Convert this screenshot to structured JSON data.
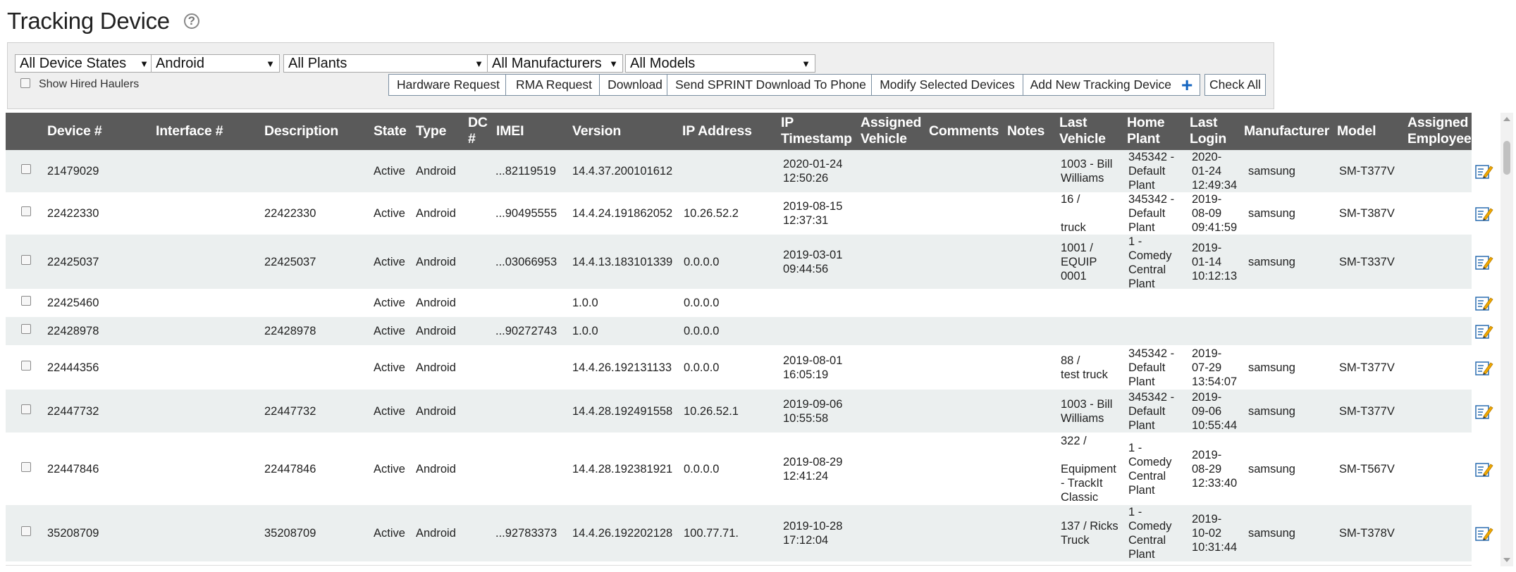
{
  "page": {
    "title": "Tracking Device"
  },
  "filters": {
    "device_state": "All Device States",
    "platform": "Android",
    "plants": "All Plants",
    "manufacturers": "All Manufacturers",
    "models": "All Models",
    "show_hired_haulers": "Show Hired Haulers"
  },
  "buttons": {
    "hardware_request": "Hardware Request",
    "rma_request": "RMA Request",
    "download": "Download",
    "send_sprint": "Send SPRINT Download To Phone",
    "modify_selected": "Modify Selected Devices",
    "add_new": "Add New Tracking Device",
    "check_all": "Check All"
  },
  "columns": {
    "device": "Device #",
    "interface": "Interface #",
    "description": "Description",
    "state": "State",
    "type": "Type",
    "dc_1": "DC",
    "dc_2": "#",
    "imei": "IMEI",
    "version": "Version",
    "ip_address": "IP Address",
    "ip_ts_1": "IP",
    "ip_ts_2": "Timestamp",
    "assigned_vehicle_1": "Assigned",
    "assigned_vehicle_2": "Vehicle",
    "comments": "Comments",
    "notes": "Notes",
    "last_vehicle_1": "Last",
    "last_vehicle_2": "Vehicle",
    "home_plant_1": "Home",
    "home_plant_2": "Plant",
    "last_login_1": "Last",
    "last_login_2": "Login",
    "manufacturer": "Manufacturer",
    "model": "Model",
    "assigned_employee_1": "Assigned",
    "assigned_employee_2": "Employee"
  },
  "rows": [
    {
      "device": "21479029",
      "interface": "",
      "description": "",
      "state": "Active",
      "type": "Android",
      "imei": "...82119519",
      "version": "14.4.37.200101612",
      "ip": "",
      "ip_ts": [
        "2020-01-24",
        "12:50:26"
      ],
      "last_vehicle": [
        "1003 - Bill",
        "Williams"
      ],
      "home_plant": [
        "345342 -",
        "Default",
        "Plant"
      ],
      "last_login": [
        "2020-",
        "01-24",
        "12:49:34"
      ],
      "manufacturer": "samsung",
      "model": "SM-T377V"
    },
    {
      "device": "22422330",
      "interface": "",
      "description": "22422330",
      "state": "Active",
      "type": "Android",
      "imei": "...90495555",
      "version": "14.4.24.191862052",
      "ip": "10.26.52.2",
      "ip_ts": [
        "2019-08-15",
        "12:37:31"
      ],
      "last_vehicle": [
        "16 /",
        "",
        "truck"
      ],
      "home_plant": [
        "345342 -",
        "Default",
        "Plant"
      ],
      "last_login": [
        "2019-",
        "08-09",
        "09:41:59"
      ],
      "manufacturer": "samsung",
      "model": "SM-T387V"
    },
    {
      "device": "22425037",
      "interface": "",
      "description": "22425037",
      "state": "Active",
      "type": "Android",
      "imei": "...03066953",
      "version": "14.4.13.183101339",
      "ip": "0.0.0.0",
      "ip_ts": [
        "2019-03-01",
        "09:44:56"
      ],
      "last_vehicle": [
        "1001 /",
        "EQUIP",
        "0001"
      ],
      "home_plant": [
        "1 -",
        "Comedy",
        "Central",
        "Plant"
      ],
      "last_login": [
        "2019-",
        "01-14",
        "10:12:13"
      ],
      "manufacturer": "samsung",
      "model": "SM-T337V"
    },
    {
      "device": "22425460",
      "interface": "",
      "description": "",
      "state": "Active",
      "type": "Android",
      "imei": "",
      "version": "1.0.0",
      "ip": "0.0.0.0",
      "ip_ts": [],
      "last_vehicle": [],
      "home_plant": [],
      "last_login": [],
      "manufacturer": "",
      "model": ""
    },
    {
      "device": "22428978",
      "interface": "",
      "description": "22428978",
      "state": "Active",
      "type": "Android",
      "imei": "...90272743",
      "version": "1.0.0",
      "ip": "0.0.0.0",
      "ip_ts": [],
      "last_vehicle": [],
      "home_plant": [],
      "last_login": [],
      "manufacturer": "",
      "model": ""
    },
    {
      "device": "22444356",
      "interface": "",
      "description": "",
      "state": "Active",
      "type": "Android",
      "imei": "",
      "version": "14.4.26.192131133",
      "ip": "0.0.0.0",
      "ip_ts": [
        "2019-08-01",
        "16:05:19"
      ],
      "last_vehicle": [
        "88 /",
        "test truck"
      ],
      "home_plant": [
        "345342 -",
        "Default",
        "Plant"
      ],
      "last_login": [
        "2019-",
        "07-29",
        "13:54:07"
      ],
      "manufacturer": "samsung",
      "model": "SM-T377V"
    },
    {
      "device": "22447732",
      "interface": "",
      "description": "22447732",
      "state": "Active",
      "type": "Android",
      "imei": "",
      "version": "14.4.28.192491558",
      "ip": "10.26.52.1",
      "ip_ts": [
        "2019-09-06",
        "10:55:58"
      ],
      "last_vehicle": [
        "1003 - Bill",
        "Williams"
      ],
      "home_plant": [
        "345342 -",
        "Default",
        "Plant"
      ],
      "last_login": [
        "2019-",
        "09-06",
        "10:55:44"
      ],
      "manufacturer": "samsung",
      "model": "SM-T377V"
    },
    {
      "device": "22447846",
      "interface": "",
      "description": "22447846",
      "state": "Active",
      "type": "Android",
      "imei": "",
      "version": "14.4.28.192381921",
      "ip": "0.0.0.0",
      "ip_ts": [
        "2019-08-29",
        "12:41:24"
      ],
      "last_vehicle": [
        "322 /",
        "",
        "Equipment",
        "- TrackIt",
        "Classic"
      ],
      "home_plant": [
        "1 -",
        "Comedy",
        "Central",
        "Plant"
      ],
      "last_login": [
        "2019-",
        "08-29",
        "12:33:40"
      ],
      "manufacturer": "samsung",
      "model": "SM-T567V"
    },
    {
      "device": "35208709",
      "interface": "",
      "description": "35208709",
      "state": "Active",
      "type": "Android",
      "imei": "...92783373",
      "version": "14.4.26.192202128",
      "ip": "100.77.71.",
      "ip_ts": [
        "2019-10-28",
        "17:12:04"
      ],
      "last_vehicle": [
        "137 / Ricks",
        "Truck"
      ],
      "home_plant": [
        "1 -",
        "Comedy",
        "Central",
        "Plant"
      ],
      "last_login": [
        "2019-",
        "10-02",
        "10:31:44"
      ],
      "manufacturer": "samsung",
      "model": "SM-T378V"
    }
  ]
}
